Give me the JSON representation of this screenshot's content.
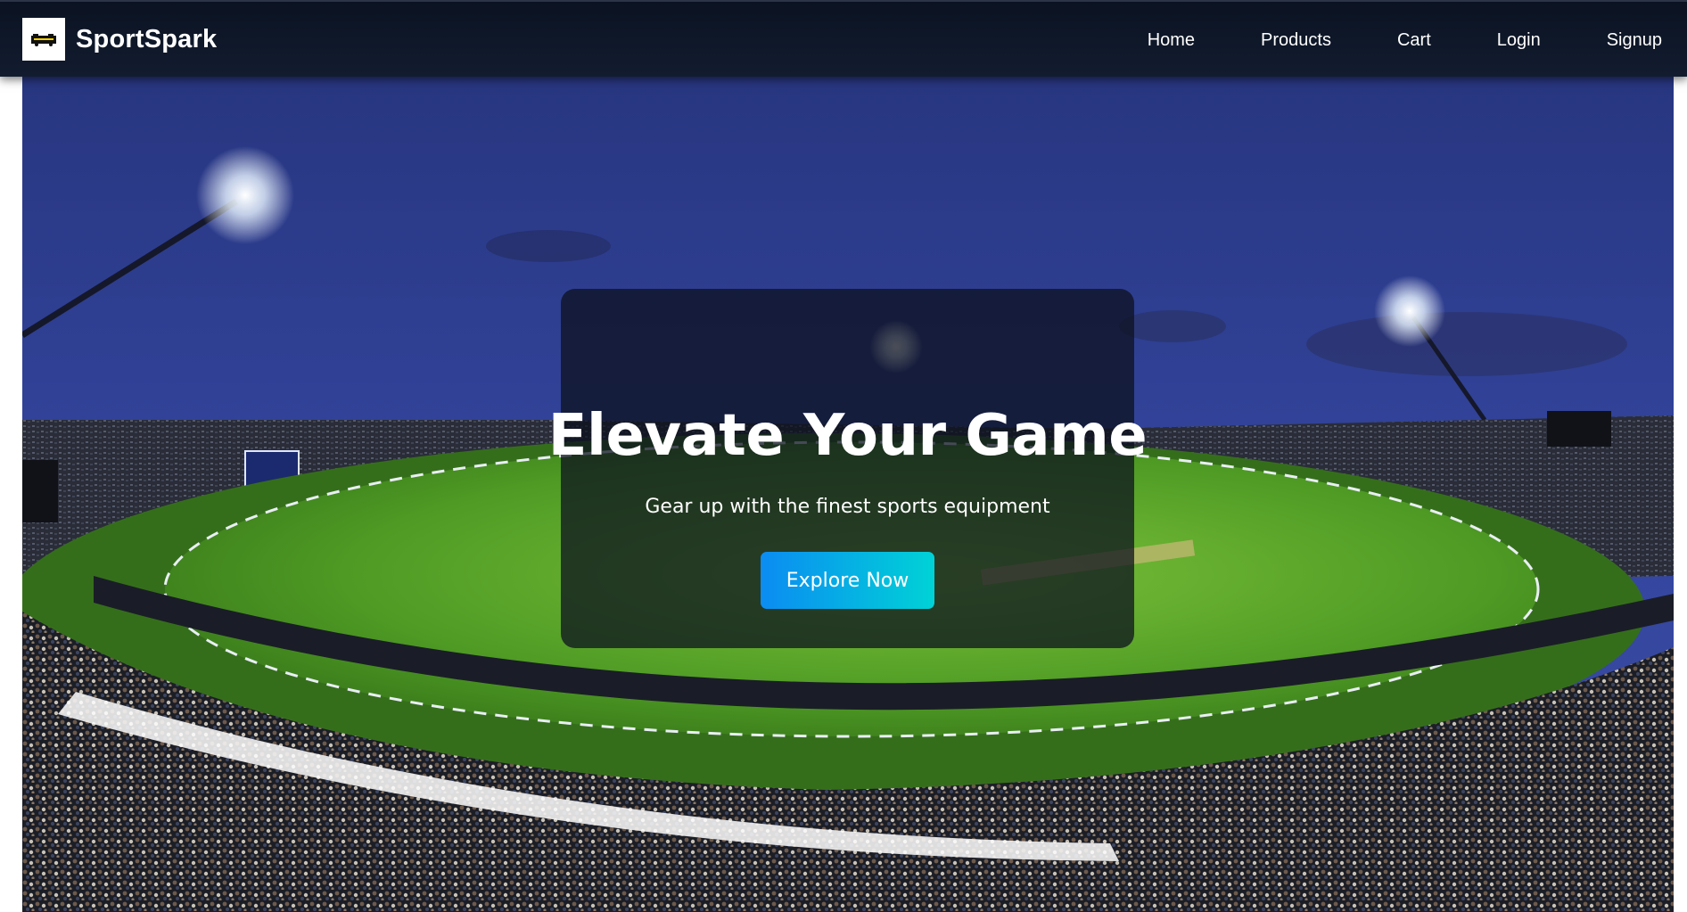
{
  "brand": {
    "name": "SportSpark",
    "logo_icon": "sportspark-logo-icon"
  },
  "nav": {
    "items": [
      {
        "label": "Home"
      },
      {
        "label": "Products"
      },
      {
        "label": "Cart"
      },
      {
        "label": "Login"
      },
      {
        "label": "Signup"
      }
    ]
  },
  "hero": {
    "title": "Elevate Your Game",
    "subtitle": "Gear up with the finest sports equipment",
    "cta_label": "Explore Now",
    "background_icon": "cricket-stadium-night-image"
  },
  "colors": {
    "navbar": "#0f1829",
    "cta_start": "#0b8cf2",
    "cta_end": "#00d2d6",
    "card_overlay": "#0c101e",
    "sky": "#2b3a86",
    "field": "#4c9a22"
  }
}
